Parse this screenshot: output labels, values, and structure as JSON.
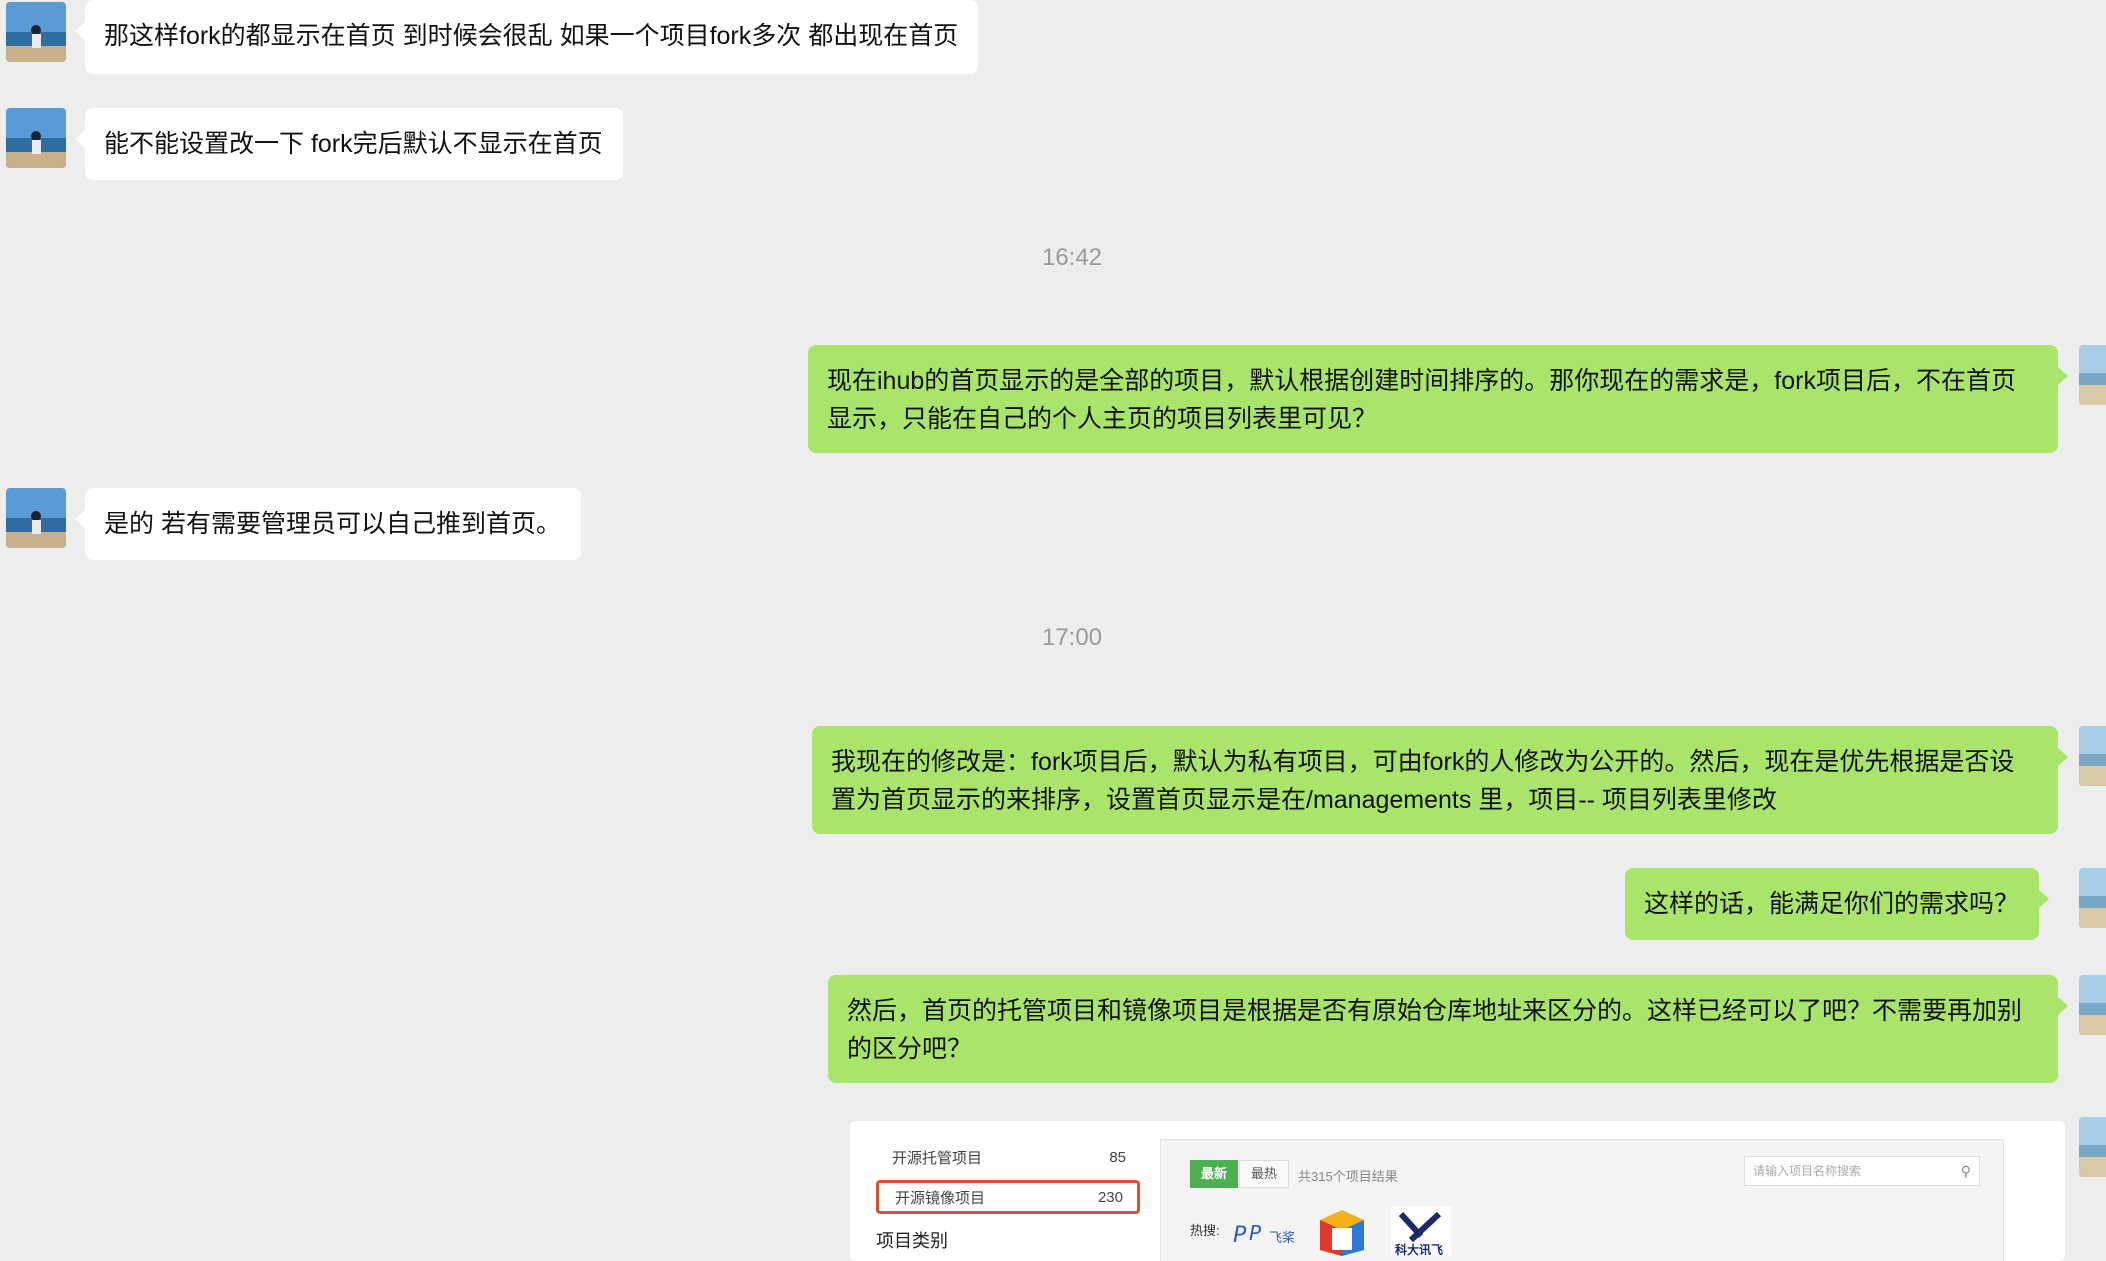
{
  "chat": {
    "messages": [
      {
        "side": "in",
        "text": "那这样fork的都显示在首页 到时候会很乱 如果一个项目fork多次 都出现在首页"
      },
      {
        "side": "in",
        "text": "能不能设置改一下 fork完后默认不显示在首页"
      },
      {
        "side": "out",
        "text": "现在ihub的首页显示的是全部的项目，默认根据创建时间排序的。那你现在的需求是，fork项目后，不在首页显示，只能在自己的个人主页的项目列表里可见？"
      },
      {
        "side": "in",
        "text": "是的 若有需要管理员可以自己推到首页。"
      },
      {
        "side": "out",
        "text": "我现在的修改是：fork项目后，默认为私有项目，可由fork的人修改为公开的。然后，现在是优先根据是否设置为首页显示的来排序，设置首页显示是在/managements 里，项目-- 项目列表里修改"
      },
      {
        "side": "out",
        "text": "这样的话，能满足你们的需求吗？"
      },
      {
        "side": "out",
        "text": "然后，首页的托管项目和镜像项目是根据是否有原始仓库地址来区分的。这样已经可以了吧？不需要再加别的区分吧？"
      }
    ],
    "timestamps": [
      "16:42",
      "17:00"
    ]
  },
  "embedded_screenshot": {
    "sidebar": [
      {
        "label": "开源托管项目",
        "count": "85"
      },
      {
        "label": "开源镜像项目",
        "count": "230"
      }
    ],
    "sidebar_heading": "项目类别",
    "tabs": [
      "最新",
      "最热"
    ],
    "result_count": "共315个项目结果",
    "search_placeholder": "请输入项目名称搜索",
    "hot_label": "热搜:",
    "logo_text": [
      "飞桨",
      "科大讯飞"
    ]
  },
  "colors": {
    "background": "#ededed",
    "incoming_bubble": "#ffffff",
    "outgoing_bubble": "#a9e46b",
    "timestamp": "#9a9a9a",
    "highlight_border": "#e1522b",
    "tab_active": "#4caf50"
  }
}
